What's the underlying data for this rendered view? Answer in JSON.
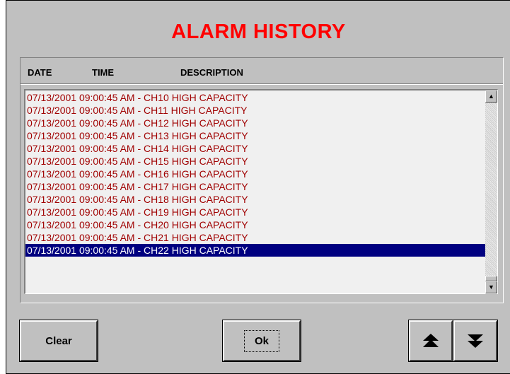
{
  "window": {
    "title": "ALARM HISTORY",
    "title_color": "#ff0000"
  },
  "columns": {
    "date": "DATE",
    "time": "TIME",
    "description": "DESCRIPTION"
  },
  "alarms": [
    "07/13/2001 09:00:45 AM - CH10 HIGH CAPACITY",
    "07/13/2001 09:00:45 AM - CH11 HIGH CAPACITY",
    "07/13/2001 09:00:45 AM - CH12 HIGH CAPACITY",
    "07/13/2001 09:00:45 AM - CH13 HIGH CAPACITY",
    "07/13/2001 09:00:45 AM - CH14 HIGH CAPACITY",
    "07/13/2001 09:00:45 AM - CH15 HIGH CAPACITY",
    "07/13/2001 09:00:45 AM - CH16 HIGH CAPACITY",
    "07/13/2001 09:00:45 AM - CH17 HIGH CAPACITY",
    "07/13/2001 09:00:45 AM - CH18 HIGH CAPACITY",
    "07/13/2001 09:00:45 AM - CH19 HIGH CAPACITY",
    "07/13/2001 09:00:45 AM - CH20 HIGH CAPACITY",
    "07/13/2001 09:00:45 AM - CH21 HIGH CAPACITY",
    "07/13/2001 09:00:45 AM - CH22 HIGH CAPACITY"
  ],
  "selected_index": 12,
  "alarm_text_color": "#a00000",
  "selection_color": "#000080",
  "scrollbar": {
    "up_icon": "scroll-up-arrow",
    "down_icon": "scroll-down-arrow",
    "position": 1.0
  },
  "buttons": {
    "clear": "Clear",
    "ok": "Ok",
    "page_up_icon": "double-up-arrow",
    "page_down_icon": "double-down-arrow"
  }
}
